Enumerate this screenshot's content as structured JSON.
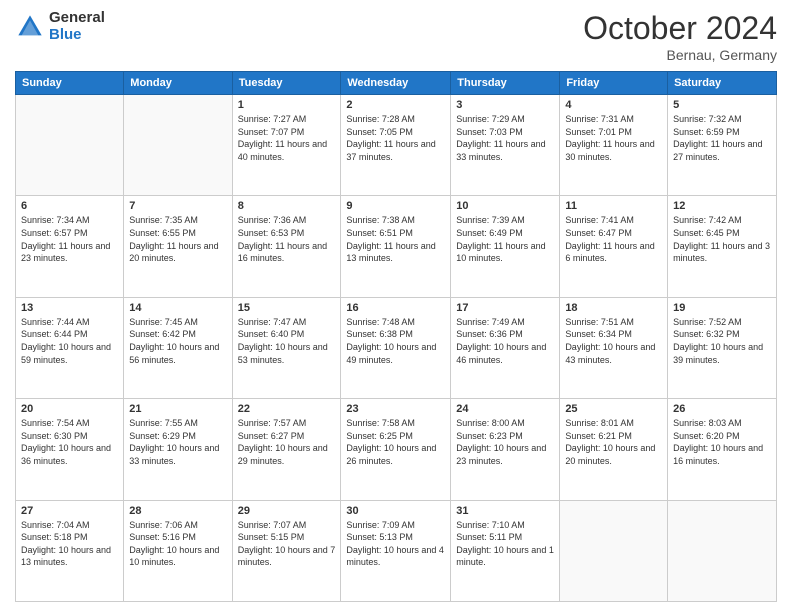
{
  "logo": {
    "line1": "General",
    "line2": "Blue"
  },
  "header": {
    "month": "October 2024",
    "location": "Bernau, Germany"
  },
  "weekdays": [
    "Sunday",
    "Monday",
    "Tuesday",
    "Wednesday",
    "Thursday",
    "Friday",
    "Saturday"
  ],
  "weeks": [
    [
      {
        "day": "",
        "sunrise": "",
        "sunset": "",
        "daylight": ""
      },
      {
        "day": "",
        "sunrise": "",
        "sunset": "",
        "daylight": ""
      },
      {
        "day": "1",
        "sunrise": "Sunrise: 7:27 AM",
        "sunset": "Sunset: 7:07 PM",
        "daylight": "Daylight: 11 hours and 40 minutes."
      },
      {
        "day": "2",
        "sunrise": "Sunrise: 7:28 AM",
        "sunset": "Sunset: 7:05 PM",
        "daylight": "Daylight: 11 hours and 37 minutes."
      },
      {
        "day": "3",
        "sunrise": "Sunrise: 7:29 AM",
        "sunset": "Sunset: 7:03 PM",
        "daylight": "Daylight: 11 hours and 33 minutes."
      },
      {
        "day": "4",
        "sunrise": "Sunrise: 7:31 AM",
        "sunset": "Sunset: 7:01 PM",
        "daylight": "Daylight: 11 hours and 30 minutes."
      },
      {
        "day": "5",
        "sunrise": "Sunrise: 7:32 AM",
        "sunset": "Sunset: 6:59 PM",
        "daylight": "Daylight: 11 hours and 27 minutes."
      }
    ],
    [
      {
        "day": "6",
        "sunrise": "Sunrise: 7:34 AM",
        "sunset": "Sunset: 6:57 PM",
        "daylight": "Daylight: 11 hours and 23 minutes."
      },
      {
        "day": "7",
        "sunrise": "Sunrise: 7:35 AM",
        "sunset": "Sunset: 6:55 PM",
        "daylight": "Daylight: 11 hours and 20 minutes."
      },
      {
        "day": "8",
        "sunrise": "Sunrise: 7:36 AM",
        "sunset": "Sunset: 6:53 PM",
        "daylight": "Daylight: 11 hours and 16 minutes."
      },
      {
        "day": "9",
        "sunrise": "Sunrise: 7:38 AM",
        "sunset": "Sunset: 6:51 PM",
        "daylight": "Daylight: 11 hours and 13 minutes."
      },
      {
        "day": "10",
        "sunrise": "Sunrise: 7:39 AM",
        "sunset": "Sunset: 6:49 PM",
        "daylight": "Daylight: 11 hours and 10 minutes."
      },
      {
        "day": "11",
        "sunrise": "Sunrise: 7:41 AM",
        "sunset": "Sunset: 6:47 PM",
        "daylight": "Daylight: 11 hours and 6 minutes."
      },
      {
        "day": "12",
        "sunrise": "Sunrise: 7:42 AM",
        "sunset": "Sunset: 6:45 PM",
        "daylight": "Daylight: 11 hours and 3 minutes."
      }
    ],
    [
      {
        "day": "13",
        "sunrise": "Sunrise: 7:44 AM",
        "sunset": "Sunset: 6:44 PM",
        "daylight": "Daylight: 10 hours and 59 minutes."
      },
      {
        "day": "14",
        "sunrise": "Sunrise: 7:45 AM",
        "sunset": "Sunset: 6:42 PM",
        "daylight": "Daylight: 10 hours and 56 minutes."
      },
      {
        "day": "15",
        "sunrise": "Sunrise: 7:47 AM",
        "sunset": "Sunset: 6:40 PM",
        "daylight": "Daylight: 10 hours and 53 minutes."
      },
      {
        "day": "16",
        "sunrise": "Sunrise: 7:48 AM",
        "sunset": "Sunset: 6:38 PM",
        "daylight": "Daylight: 10 hours and 49 minutes."
      },
      {
        "day": "17",
        "sunrise": "Sunrise: 7:49 AM",
        "sunset": "Sunset: 6:36 PM",
        "daylight": "Daylight: 10 hours and 46 minutes."
      },
      {
        "day": "18",
        "sunrise": "Sunrise: 7:51 AM",
        "sunset": "Sunset: 6:34 PM",
        "daylight": "Daylight: 10 hours and 43 minutes."
      },
      {
        "day": "19",
        "sunrise": "Sunrise: 7:52 AM",
        "sunset": "Sunset: 6:32 PM",
        "daylight": "Daylight: 10 hours and 39 minutes."
      }
    ],
    [
      {
        "day": "20",
        "sunrise": "Sunrise: 7:54 AM",
        "sunset": "Sunset: 6:30 PM",
        "daylight": "Daylight: 10 hours and 36 minutes."
      },
      {
        "day": "21",
        "sunrise": "Sunrise: 7:55 AM",
        "sunset": "Sunset: 6:29 PM",
        "daylight": "Daylight: 10 hours and 33 minutes."
      },
      {
        "day": "22",
        "sunrise": "Sunrise: 7:57 AM",
        "sunset": "Sunset: 6:27 PM",
        "daylight": "Daylight: 10 hours and 29 minutes."
      },
      {
        "day": "23",
        "sunrise": "Sunrise: 7:58 AM",
        "sunset": "Sunset: 6:25 PM",
        "daylight": "Daylight: 10 hours and 26 minutes."
      },
      {
        "day": "24",
        "sunrise": "Sunrise: 8:00 AM",
        "sunset": "Sunset: 6:23 PM",
        "daylight": "Daylight: 10 hours and 23 minutes."
      },
      {
        "day": "25",
        "sunrise": "Sunrise: 8:01 AM",
        "sunset": "Sunset: 6:21 PM",
        "daylight": "Daylight: 10 hours and 20 minutes."
      },
      {
        "day": "26",
        "sunrise": "Sunrise: 8:03 AM",
        "sunset": "Sunset: 6:20 PM",
        "daylight": "Daylight: 10 hours and 16 minutes."
      }
    ],
    [
      {
        "day": "27",
        "sunrise": "Sunrise: 7:04 AM",
        "sunset": "Sunset: 5:18 PM",
        "daylight": "Daylight: 10 hours and 13 minutes."
      },
      {
        "day": "28",
        "sunrise": "Sunrise: 7:06 AM",
        "sunset": "Sunset: 5:16 PM",
        "daylight": "Daylight: 10 hours and 10 minutes."
      },
      {
        "day": "29",
        "sunrise": "Sunrise: 7:07 AM",
        "sunset": "Sunset: 5:15 PM",
        "daylight": "Daylight: 10 hours and 7 minutes."
      },
      {
        "day": "30",
        "sunrise": "Sunrise: 7:09 AM",
        "sunset": "Sunset: 5:13 PM",
        "daylight": "Daylight: 10 hours and 4 minutes."
      },
      {
        "day": "31",
        "sunrise": "Sunrise: 7:10 AM",
        "sunset": "Sunset: 5:11 PM",
        "daylight": "Daylight: 10 hours and 1 minute."
      },
      {
        "day": "",
        "sunrise": "",
        "sunset": "",
        "daylight": ""
      },
      {
        "day": "",
        "sunrise": "",
        "sunset": "",
        "daylight": ""
      }
    ]
  ]
}
